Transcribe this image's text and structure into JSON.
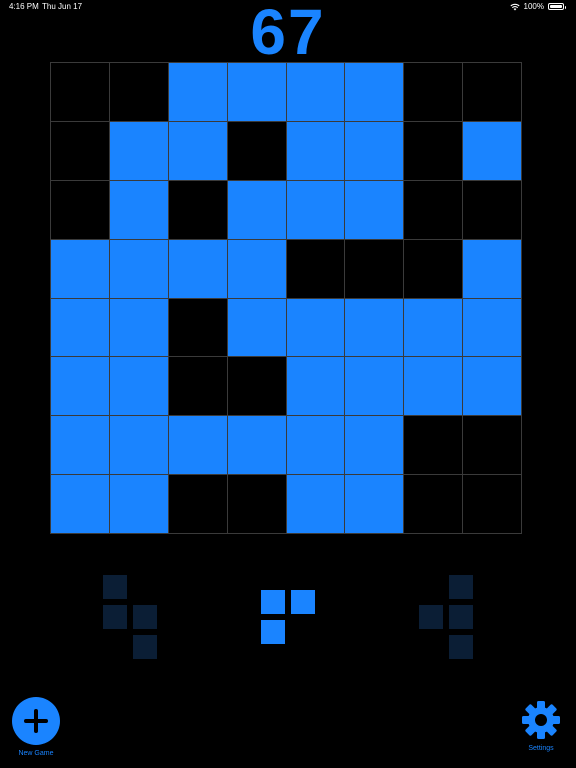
{
  "status_bar": {
    "time": "4:16 PM",
    "date": "Thu Jun 17",
    "battery_text": "100%",
    "battery_level": 1.0
  },
  "game": {
    "score": "67",
    "accent_color": "#1a84ff",
    "board": [
      [
        0,
        0,
        1,
        1,
        1,
        1,
        0,
        0
      ],
      [
        0,
        1,
        1,
        0,
        1,
        1,
        0,
        1
      ],
      [
        0,
        1,
        0,
        1,
        1,
        1,
        0,
        0
      ],
      [
        1,
        1,
        1,
        1,
        0,
        0,
        0,
        1
      ],
      [
        1,
        1,
        0,
        1,
        1,
        1,
        1,
        1
      ],
      [
        1,
        1,
        0,
        0,
        1,
        1,
        1,
        1
      ],
      [
        1,
        1,
        1,
        1,
        1,
        1,
        0,
        0
      ],
      [
        1,
        1,
        0,
        0,
        1,
        1,
        0,
        0
      ]
    ],
    "pieces": [
      {
        "state": "disabled",
        "cells": [
          [
            0,
            0
          ],
          [
            1,
            0
          ],
          [
            1,
            1
          ],
          [
            2,
            1
          ]
        ]
      },
      {
        "state": "available",
        "cells": [
          [
            0,
            0
          ],
          [
            0,
            1
          ],
          [
            1,
            0
          ]
        ]
      },
      {
        "state": "disabled",
        "cells": [
          [
            0,
            1
          ],
          [
            1,
            0
          ],
          [
            1,
            1
          ],
          [
            2,
            1
          ]
        ]
      }
    ]
  },
  "toolbar": {
    "new_game_label": "New Game",
    "new_game_icon": "plus-circle-icon",
    "settings_label": "Settings",
    "settings_icon": "gear-icon"
  }
}
